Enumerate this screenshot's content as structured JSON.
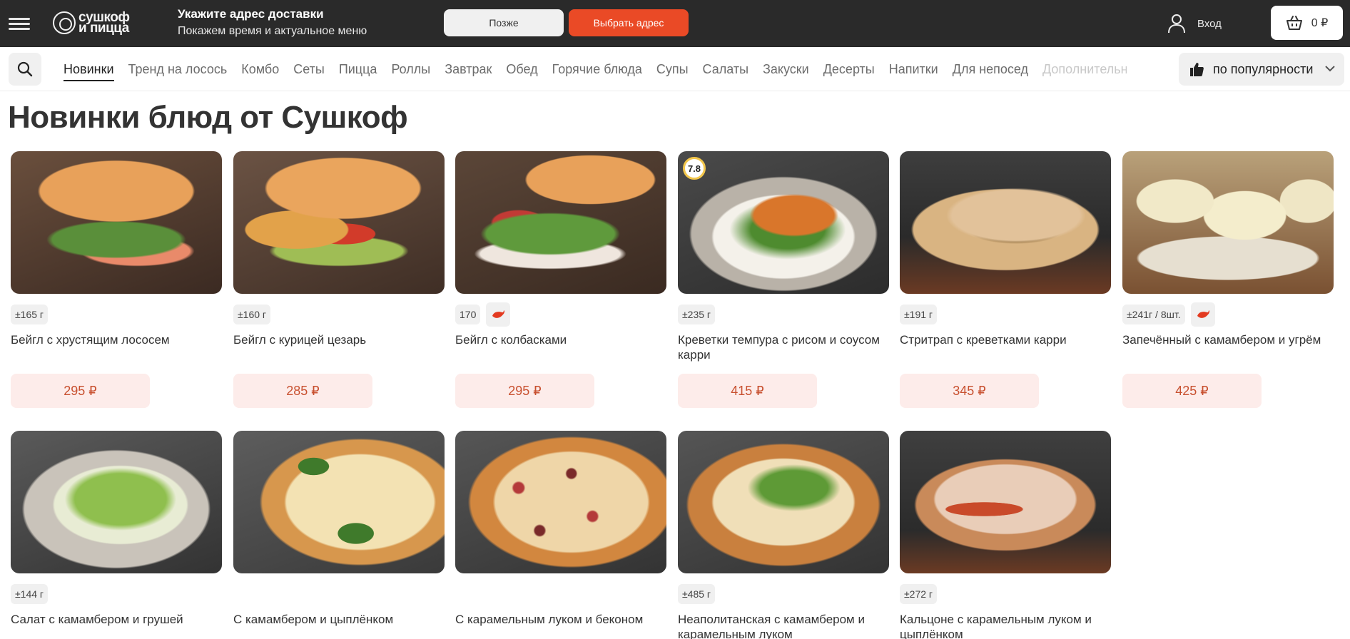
{
  "header": {
    "logo_line1": "сушкоф",
    "logo_line2": "и пицца",
    "address_title": "Укажите адрес доставки",
    "address_subtitle": "Покажем время и актуальное меню",
    "later_label": "Позже",
    "choose_label": "Выбрать адрес",
    "login_label": "Вход",
    "cart_total": "0 ₽"
  },
  "nav": {
    "categories": [
      "Новинки",
      "Тренд на лосось",
      "Комбо",
      "Сеты",
      "Пицца",
      "Роллы",
      "Завтрак",
      "Обед",
      "Горячие блюда",
      "Супы",
      "Салаты",
      "Закуски",
      "Десерты",
      "Напитки",
      "Для непосед",
      "Дополнительно"
    ],
    "sort_label": "по популярности"
  },
  "page": {
    "title": "Новинки блюд от Сушкоф"
  },
  "products": [
    {
      "weight": "±165 г",
      "spicy": false,
      "name": "Бейгл с хрустящим лососем",
      "price": "295 ₽"
    },
    {
      "weight": "±160 г",
      "spicy": false,
      "name": "Бейгл с курицей цезарь",
      "price": "285 ₽"
    },
    {
      "weight": "170",
      "spicy": true,
      "name": "Бейгл с колбасками",
      "price": "295 ₽"
    },
    {
      "weight": "±235 г",
      "spicy": false,
      "rating": "7.8",
      "name": "Креветки темпура с рисом и соусом карри",
      "price": "415 ₽"
    },
    {
      "weight": "±191 г",
      "spicy": false,
      "name": "Стритрап с креветками карри",
      "price": "345 ₽"
    },
    {
      "weight": "±241г / 8шт.",
      "spicy": true,
      "name": "Запечённый с камамбером и угрём",
      "price": "425 ₽"
    },
    {
      "weight": "±144 г",
      "spicy": false,
      "name": "Салат с камамбером и грушей"
    },
    {
      "weight": "",
      "spicy": false,
      "name": "С камамбером и цыплёнком"
    },
    {
      "weight": "",
      "spicy": false,
      "name": "С карамельным луком и беконом"
    },
    {
      "weight": "±485 г",
      "spicy": false,
      "name": "Неаполитанская с камамбером и карамельным луком"
    },
    {
      "weight": "±272 г",
      "spicy": false,
      "name": "Кальцоне с карамельным луком и цыплёнком"
    }
  ],
  "colors": {
    "topbar": "#2a2a2a",
    "accent": "#ea4a26",
    "price_bg": "#fdecea",
    "price_text": "#c8502f"
  }
}
